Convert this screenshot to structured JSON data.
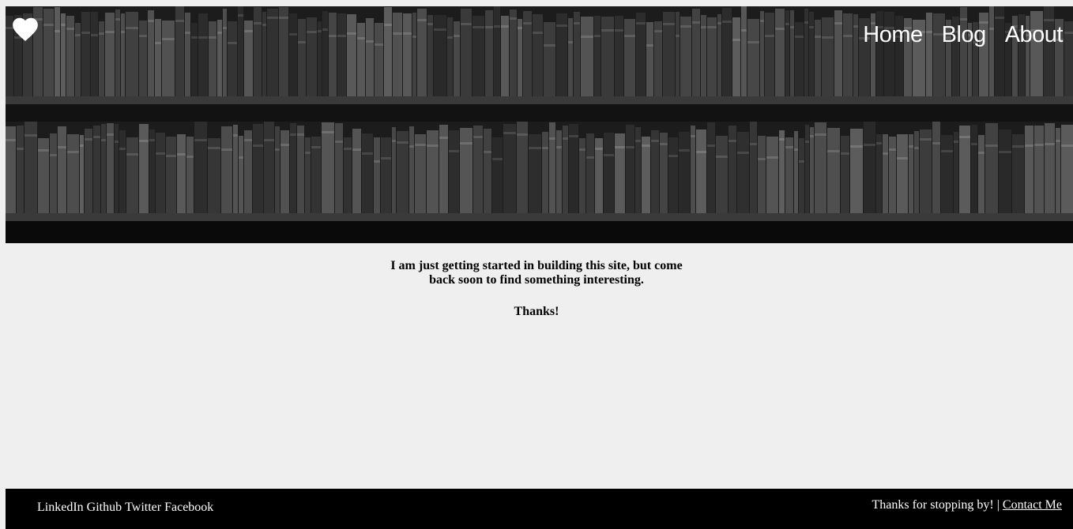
{
  "header": {
    "logo_icon": "heart-icon",
    "nav": {
      "home": "Home",
      "blog": "Blog",
      "about": "About"
    }
  },
  "main": {
    "intro": "I am just getting started in building this site, but come back soon to find something interesting.",
    "thanks": "Thanks!"
  },
  "footer": {
    "social": {
      "linkedin": "LinkedIn",
      "github": "Github",
      "twitter": "Twitter",
      "facebook": "Facebook"
    },
    "message": "Thanks for stopping by!",
    "separator": "|",
    "contact": "Contact Me"
  },
  "colors": {
    "background": "#efefef",
    "footer_bg": "#000000",
    "nav_text": "#ffffff"
  }
}
